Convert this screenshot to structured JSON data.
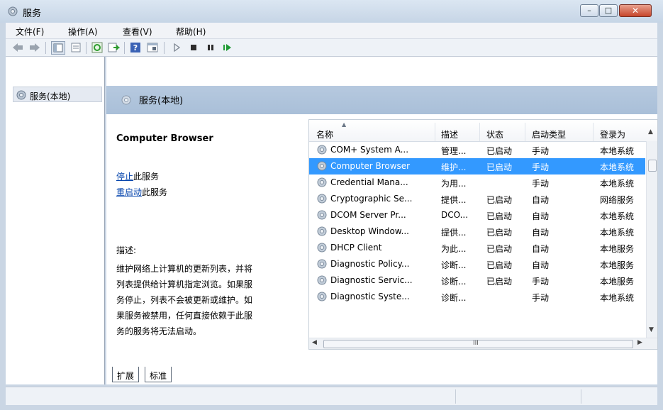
{
  "window": {
    "title": "服务",
    "controls": {
      "minimize": "–",
      "maximize": "□",
      "close": "✕"
    }
  },
  "menubar": [
    "文件(F)",
    "操作(A)",
    "查看(V)",
    "帮助(H)"
  ],
  "toolbar": {
    "icons": [
      "back-icon",
      "forward-icon",
      "show-hide-tree-icon",
      "properties-icon",
      "refresh-icon",
      "export-list-icon",
      "help-icon",
      "console-icon",
      "start-icon",
      "stop-icon",
      "pause-icon",
      "restart-icon"
    ]
  },
  "tree": {
    "root_label": "服务(本地)"
  },
  "panel": {
    "title": "服务(本地)"
  },
  "details": {
    "service_name": "Computer Browser",
    "stop_link": "停止",
    "stop_suffix": "此服务",
    "restart_link": "重启动",
    "restart_suffix": "此服务",
    "desc_label": "描述:",
    "desc_lines": [
      "维护网络上计算机的更新列表，并将",
      "列表提供给计算机指定浏览。如果服",
      "务停止，列表不会被更新或维护。如",
      "果服务被禁用，任何直接依赖于此服",
      "务的服务将无法启动。"
    ]
  },
  "list": {
    "headers": [
      "名称",
      "描述",
      "状态",
      "启动类型",
      "登录为"
    ],
    "rows": [
      {
        "name": "COM+ System A...",
        "desc": "管理...",
        "status": "已启动",
        "startup": "手动",
        "logon": "本地系统"
      },
      {
        "name": "Computer Browser",
        "desc": "维护...",
        "status": "已启动",
        "startup": "手动",
        "logon": "本地系统"
      },
      {
        "name": "Credential Mana...",
        "desc": "为用...",
        "status": "",
        "startup": "手动",
        "logon": "本地系统"
      },
      {
        "name": "Cryptographic Se...",
        "desc": "提供...",
        "status": "已启动",
        "startup": "自动",
        "logon": "网络服务"
      },
      {
        "name": "DCOM Server Pr...",
        "desc": "DCO...",
        "status": "已启动",
        "startup": "自动",
        "logon": "本地系统"
      },
      {
        "name": "Desktop Window...",
        "desc": "提供...",
        "status": "已启动",
        "startup": "自动",
        "logon": "本地系统"
      },
      {
        "name": "DHCP Client",
        "desc": "为此...",
        "status": "已启动",
        "startup": "自动",
        "logon": "本地服务"
      },
      {
        "name": "Diagnostic Policy...",
        "desc": "诊断...",
        "status": "已启动",
        "startup": "自动",
        "logon": "本地服务"
      },
      {
        "name": "Diagnostic Servic...",
        "desc": "诊断...",
        "status": "已启动",
        "startup": "手动",
        "logon": "本地服务"
      },
      {
        "name": "Diagnostic Syste...",
        "desc": "诊断...",
        "status": "",
        "startup": "手动",
        "logon": "本地系统"
      }
    ],
    "selected_index": 1,
    "hscroll_grip": "III"
  },
  "tabs": [
    "扩展",
    "标准"
  ],
  "colors": {
    "selection": "#3399ff",
    "link": "#0645ad"
  }
}
